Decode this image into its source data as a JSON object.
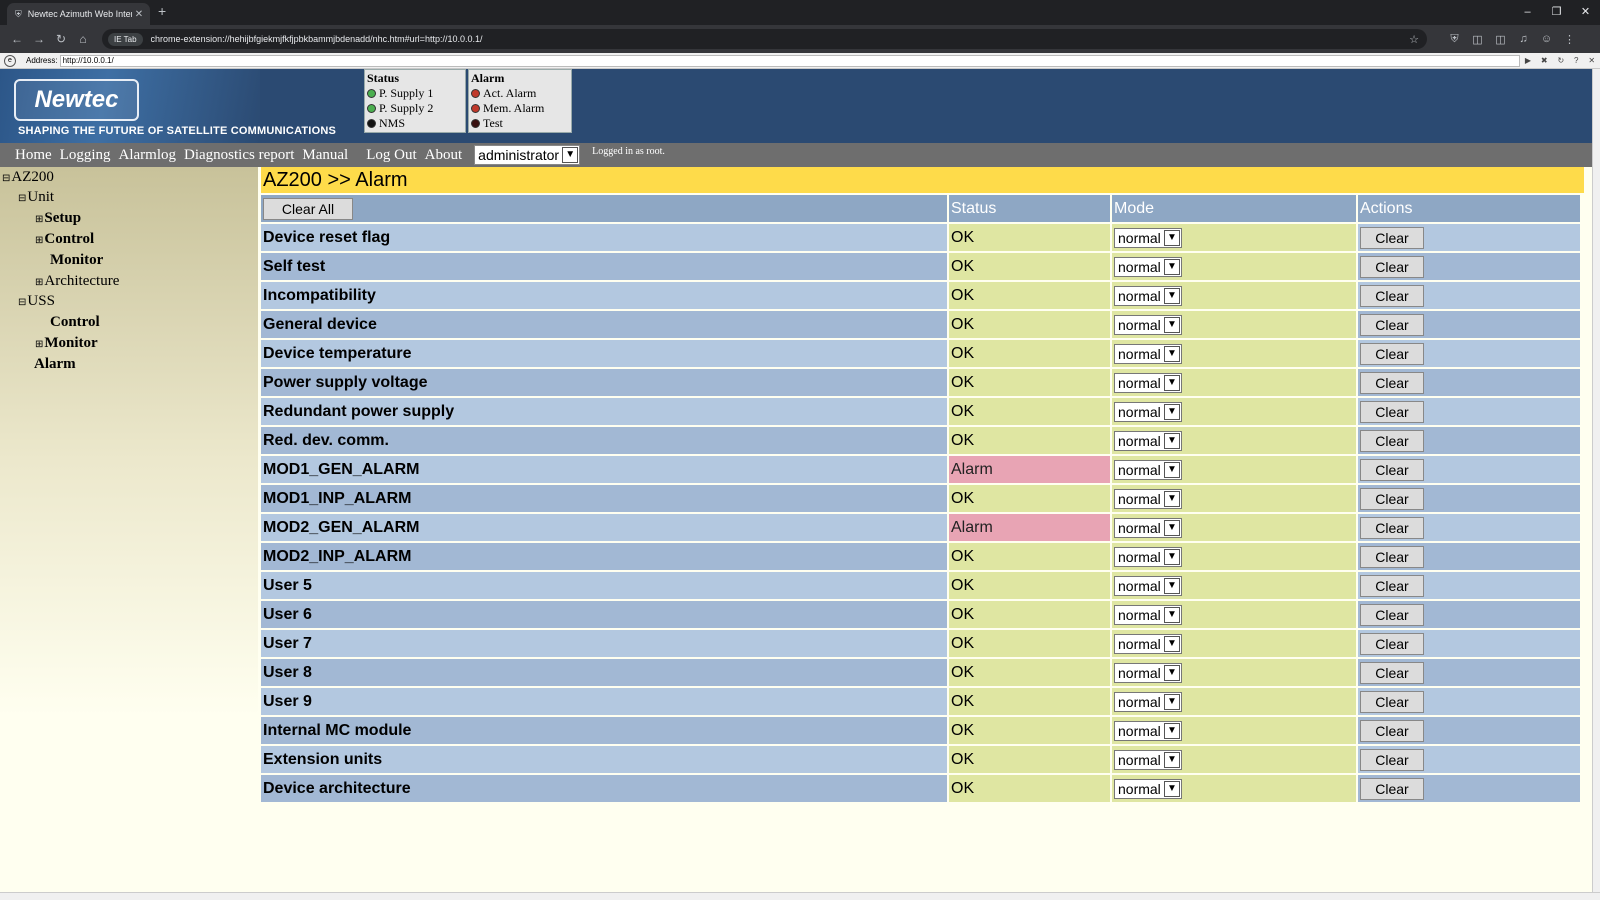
{
  "browser": {
    "tab_title": "Newtec Azimuth Web Interface",
    "tab_icon": "shield-icon",
    "url_chip": "IE Tab",
    "url": "chrome-extension://hehijbfgiekmjfkfjpbkbammjbdenadd/nhc.htm#url=http://10.0.0.1/",
    "ie_address_label": "Address:",
    "ie_address": "http://10.0.0.1/"
  },
  "header": {
    "logo_text": "Newtec",
    "tagline": "SHAPING THE FUTURE OF SATELLITE COMMUNICATIONS",
    "status_box": {
      "title": "Status",
      "items": [
        {
          "label": "P. Supply 1",
          "color": "#4caf50"
        },
        {
          "label": "P. Supply 2",
          "color": "#4caf50"
        },
        {
          "label": "NMS",
          "color": "#111111"
        }
      ]
    },
    "alarm_box": {
      "title": "Alarm",
      "items": [
        {
          "label": "Act. Alarm",
          "color": "#c0392b"
        },
        {
          "label": "Mem. Alarm",
          "color": "#c0392b"
        },
        {
          "label": "Test",
          "color": "#3a1010"
        }
      ]
    }
  },
  "menu": {
    "items": [
      "Home",
      "Logging",
      "Alarmlog",
      "Diagnostics report",
      "Manual",
      "Log Out",
      "About"
    ],
    "role_value": "administrator",
    "logged_in": "Logged in as root."
  },
  "tree": {
    "root": "AZ200",
    "unit": "Unit",
    "setup": "Setup",
    "control": "Control",
    "monitor": "Monitor",
    "architecture": "Architecture",
    "uss": "USS",
    "uss_control": "Control",
    "uss_monitor": "Monitor",
    "alarm": "Alarm"
  },
  "main": {
    "breadcrumb": "AZ200 >> Alarm",
    "clear_all": "Clear All",
    "columns": {
      "status": "Status",
      "mode": "Mode",
      "actions": "Actions"
    },
    "mode_value": "normal",
    "action_label": "Clear",
    "rows": [
      {
        "name": "Device reset flag",
        "status": "OK"
      },
      {
        "name": "Self test",
        "status": "OK"
      },
      {
        "name": "Incompatibility",
        "status": "OK"
      },
      {
        "name": "General device",
        "status": "OK"
      },
      {
        "name": "Device temperature",
        "status": "OK"
      },
      {
        "name": "Power supply voltage",
        "status": "OK"
      },
      {
        "name": "Redundant power supply",
        "status": "OK"
      },
      {
        "name": "Red. dev. comm.",
        "status": "OK"
      },
      {
        "name": "MOD1_GEN_ALARM",
        "status": "Alarm"
      },
      {
        "name": "MOD1_INP_ALARM",
        "status": "OK"
      },
      {
        "name": "MOD2_GEN_ALARM",
        "status": "Alarm"
      },
      {
        "name": "MOD2_INP_ALARM",
        "status": "OK"
      },
      {
        "name": "User 5",
        "status": "OK"
      },
      {
        "name": "User 6",
        "status": "OK"
      },
      {
        "name": "User 7",
        "status": "OK"
      },
      {
        "name": "User 8",
        "status": "OK"
      },
      {
        "name": "User 9",
        "status": "OK"
      },
      {
        "name": "Internal MC module",
        "status": "OK"
      },
      {
        "name": "Extension units",
        "status": "OK"
      },
      {
        "name": "Device architecture",
        "status": "OK"
      }
    ]
  }
}
